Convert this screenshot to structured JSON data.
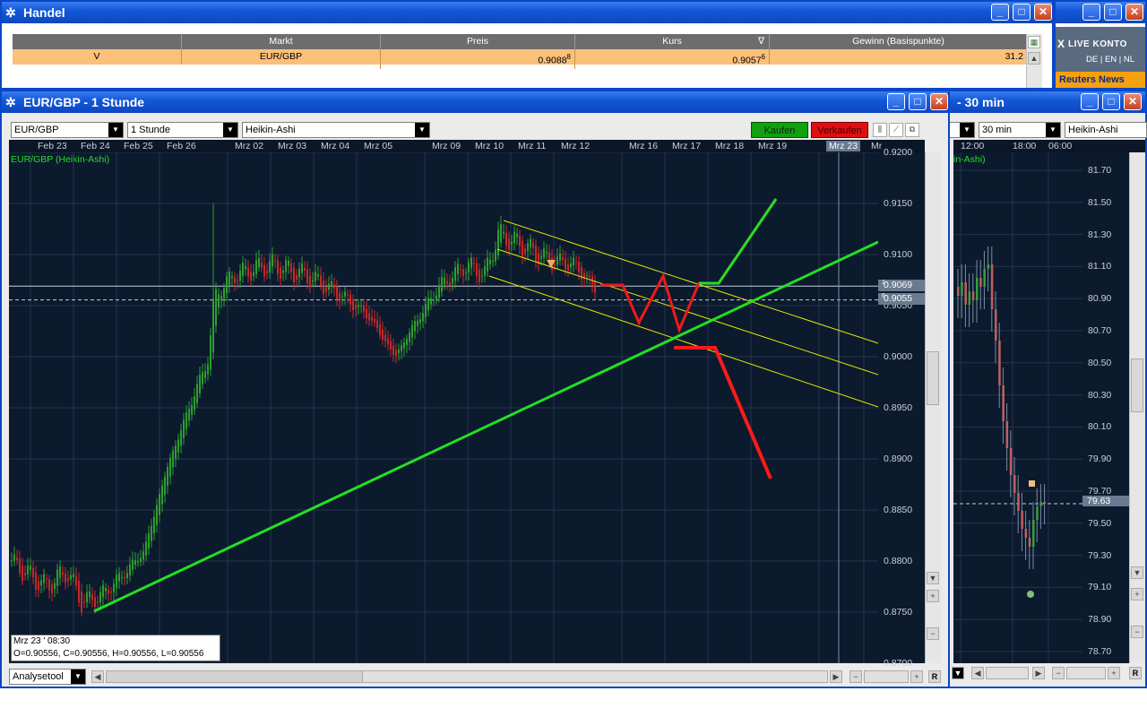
{
  "handel": {
    "title": "Handel",
    "columns": [
      "",
      "Markt",
      "Preis",
      "Kurs",
      "Gewinn (Basispunkte)"
    ],
    "kurs_sort_icon": "∇",
    "row": {
      "side": "V",
      "market": "EUR/GBP",
      "price": "0.9088",
      "price_sup": "8",
      "kurs": "0.9057",
      "kurs_sup": "6",
      "gain": "31.2"
    }
  },
  "live_window": {
    "brand": "X",
    "title": "LIVE KONTO",
    "languages": "DE | EN | NL",
    "news": "Reuters News"
  },
  "chart_main": {
    "title": "EUR/GBP - 1 Stunde",
    "symbol": "EUR/GBP",
    "interval": "1 Stunde",
    "style": "Heikin-Ashi",
    "buy_label": "Kaufen",
    "sell_label": "Verkaufen",
    "series_label": "EUR/GBP (Heikin-Ashi)",
    "dates": [
      "Feb 23",
      "Feb 24",
      "Feb 25",
      "Feb 26",
      "Mrz 02",
      "Mrz 03",
      "Mrz 04",
      "Mrz 05",
      "Mrz 09",
      "Mrz 10",
      "Mrz 11",
      "Mrz 12",
      "Mrz 16",
      "Mrz 17",
      "Mrz 18",
      "Mrz 19",
      "Mrz 23",
      "Mr"
    ],
    "y_ticks": [
      "0.9200",
      "0.9150",
      "0.9100",
      "0.9050",
      "0.9000",
      "0.8950",
      "0.8900",
      "0.8850",
      "0.8800",
      "0.8750",
      "0.8700"
    ],
    "price_tag_1": "0.9069",
    "price_tag_1_sup": "1",
    "price_tag_2": "0.9055",
    "price_tag_2_sup": "6",
    "info_date": "Mrz 23 ' 08:30",
    "info_ohlc": "O=0.90556, C=0.90556, H=0.90556, L=0.90556",
    "analysis_tool": "Analysetool",
    "r_button": "R",
    "colors": {
      "background": "#0c1a2e",
      "up": "#2e9e2e",
      "down": "#c82828",
      "trendline": "#22e022",
      "channel": "#e8e800",
      "plan_up": "#22e022",
      "plan_down": "#ff1a1a",
      "plan_mid": "#ee1a1a"
    }
  },
  "chart_side": {
    "title_fragment": "- 30 min",
    "interval": "30 min",
    "style": "Heikin-Ashi",
    "series_fragment": "in-Ashi)",
    "times": [
      "12:00",
      "18:00",
      "06:00"
    ],
    "y_ticks": [
      "81.70",
      "81.50",
      "81.30",
      "81.10",
      "80.90",
      "80.70",
      "80.50",
      "80.30",
      "80.10",
      "79.90",
      "79.70",
      "79.50",
      "79.30",
      "79.10",
      "78.90",
      "78.70"
    ],
    "price_tag": "79.63",
    "r_button": "R"
  },
  "chart_data": {
    "type": "line",
    "title": "EUR/GBP (Heikin-Ashi)",
    "xlabel": "",
    "ylabel": "",
    "ylim": [
      0.87,
      0.92
    ],
    "series": [
      {
        "name": "EUR/GBP (Heikin-Ashi)",
        "x": [
          "Feb 23",
          "Feb 24",
          "Feb 25",
          "Feb 26",
          "Mrz 02",
          "Mrz 03",
          "Mrz 04",
          "Mrz 05",
          "Mrz 09",
          "Mrz 10",
          "Mrz 11",
          "Mrz 12"
        ],
        "values": [
          0.879,
          0.876,
          0.879,
          0.893,
          0.906,
          0.908,
          0.904,
          0.901,
          0.908,
          0.912,
          0.9095,
          0.906
        ]
      }
    ],
    "price_lines": [
      0.90691,
      0.90556
    ]
  }
}
